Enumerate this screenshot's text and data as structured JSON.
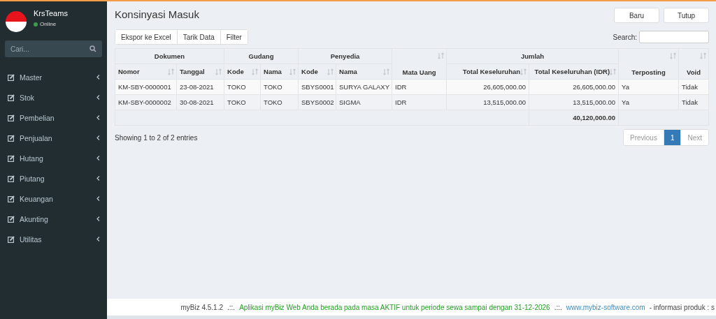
{
  "sidebar": {
    "user": "KrsTeams",
    "status": "Online",
    "search": {
      "placeholder": "Cari..."
    },
    "items": [
      {
        "label": "Master"
      },
      {
        "label": "Stok"
      },
      {
        "label": "Pembelian"
      },
      {
        "label": "Penjualan"
      },
      {
        "label": "Hutang"
      },
      {
        "label": "Piutang"
      },
      {
        "label": "Keuangan"
      },
      {
        "label": "Akunting"
      },
      {
        "label": "Utilitas"
      }
    ]
  },
  "page": {
    "title": "Konsinyasi Masuk",
    "buttons": [
      "Baru",
      "Tutup"
    ],
    "toolbar": [
      "Ekspor ke Excel",
      "Tarik Data",
      "Filter"
    ],
    "search_label": "Search:"
  },
  "table": {
    "header_groups": [
      {
        "label": "Dokumen",
        "columns": [
          {
            "label": "Nomor",
            "numeric": false
          },
          {
            "label": "Tanggal",
            "numeric": false
          }
        ]
      },
      {
        "label": "Gudang",
        "columns": [
          {
            "label": "Kode",
            "numeric": false
          },
          {
            "label": "Nama",
            "numeric": false
          }
        ]
      },
      {
        "label": "Penyedia",
        "columns": [
          {
            "label": "Kode",
            "numeric": false
          },
          {
            "label": "Nama",
            "numeric": false
          }
        ]
      },
      {
        "columns": [
          {
            "label": "Mata Uang",
            "numeric": false
          }
        ]
      },
      {
        "label": "Jumlah",
        "columns": [
          {
            "label": "Total Keseluruhan",
            "numeric": true
          },
          {
            "label": "Total Keseluruhan (IDR)",
            "numeric": true
          }
        ]
      },
      {
        "columns": [
          {
            "label": "Terposting",
            "numeric": false
          }
        ]
      },
      {
        "columns": [
          {
            "label": "Void",
            "numeric": false
          }
        ]
      }
    ],
    "rows": [
      [
        "KM-SBY-0000001",
        "23-08-2021",
        "TOKO",
        "TOKO",
        "SBYS0001",
        "SURYA GALAXY",
        "IDR",
        "26,605,000.00",
        "26,605,000.00",
        "Ya",
        "Tidak"
      ],
      [
        "KM-SBY-0000002",
        "30-08-2021",
        "TOKO",
        "TOKO",
        "SBYS0002",
        "SIGMA",
        "IDR",
        "13,515,000.00",
        "13,515,000.00",
        "Ya",
        "Tidak"
      ]
    ],
    "total": "40,120,000.00",
    "info": "Showing 1 to 2 of 2 entries"
  },
  "pagination": [
    {
      "label": "Previous",
      "selected": false
    },
    {
      "label": "1",
      "selected": true
    },
    {
      "label": "Next",
      "selected": false
    }
  ],
  "footer": {
    "version": "myBiz 4.5.1.2",
    "separator_1": ".::.",
    "message": "Aplikasi myBiz Web Anda berada pada masa AKTIF untuk periode sewa sampai dengan 31-12-2026",
    "separator_2": ".::.",
    "link": "www.mybiz-software.com",
    "extra": "- informasi produk : s"
  }
}
